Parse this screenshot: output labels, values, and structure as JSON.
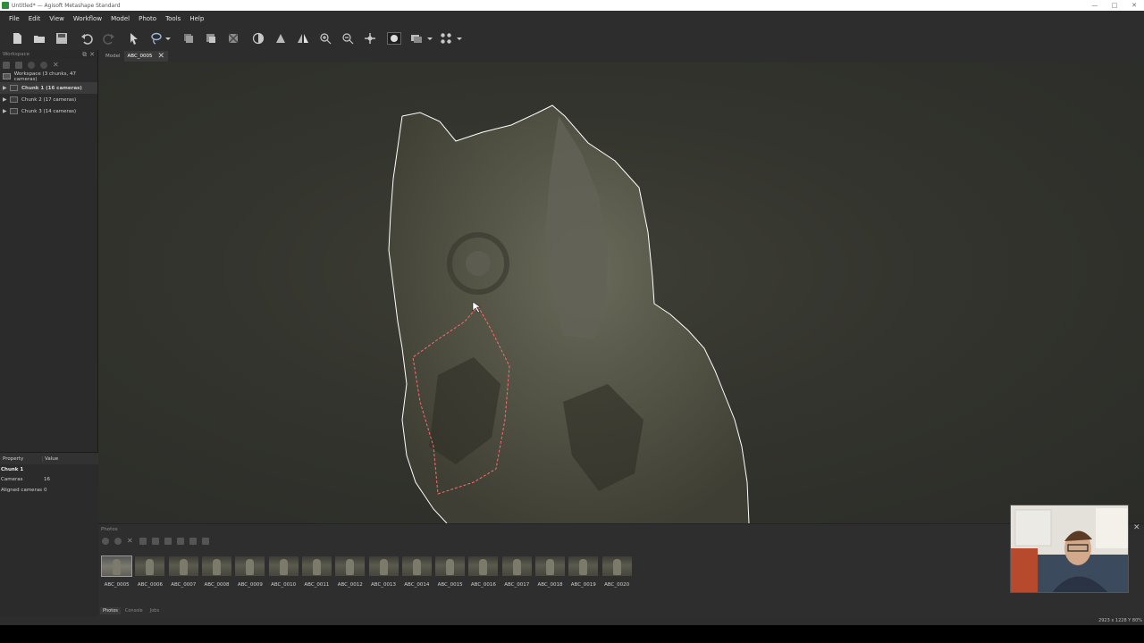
{
  "window": {
    "title": "Untitled* — Agisoft Metashape Standard",
    "min": "—",
    "max": "□",
    "close": "✕"
  },
  "menu": [
    "File",
    "Edit",
    "View",
    "Workflow",
    "Model",
    "Photo",
    "Tools",
    "Help"
  ],
  "toolbar_icons": [
    "new-file-icon",
    "open-folder-icon",
    "save-icon",
    "undo-icon",
    "redo-icon",
    "select-arrow-icon",
    "lasso-select-icon",
    "crop-icon",
    "trim-icon",
    "delete-selection-icon",
    "contrast-icon",
    "rotate-icon",
    "flip-icon",
    "zoom-in-icon",
    "zoom-out-icon",
    "move-icon",
    "mask-icon",
    "view-mode-icon",
    "grid-view-icon"
  ],
  "workspace": {
    "panel_title": "Workspace",
    "root": "Workspace (3 chunks, 47 cameras)",
    "chunks": [
      "Chunk 1 (16 cameras)",
      "Chunk 2 (17 cameras)",
      "Chunk 3 (14 cameras)"
    ]
  },
  "properties": {
    "col_property": "Property",
    "col_value": "Value",
    "group": "Chunk 1",
    "rows": [
      {
        "key": "Cameras",
        "value": "16"
      },
      {
        "key": "Aligned cameras",
        "value": "0"
      }
    ]
  },
  "tabs": {
    "model": "Model",
    "photo": "ABC_0005",
    "close": "✕"
  },
  "photos": {
    "panel_title": "Photos",
    "selected_index": 0,
    "items": [
      "ABC_0005",
      "ABC_0006",
      "ABC_0007",
      "ABC_0008",
      "ABC_0009",
      "ABC_0010",
      "ABC_0011",
      "ABC_0012",
      "ABC_0013",
      "ABC_0014",
      "ABC_0015",
      "ABC_0016",
      "ABC_0017",
      "ABC_0018",
      "ABC_0019",
      "ABC_0020"
    ],
    "bottom_tabs": [
      "Photos",
      "Console",
      "Jobs"
    ]
  },
  "status": {
    "dims": "2923 x 1228 Y 80%"
  },
  "colors": {
    "selection_line": "#ff6b6b",
    "mask_outline": "#ffffff",
    "background": "#2d2d2d"
  }
}
